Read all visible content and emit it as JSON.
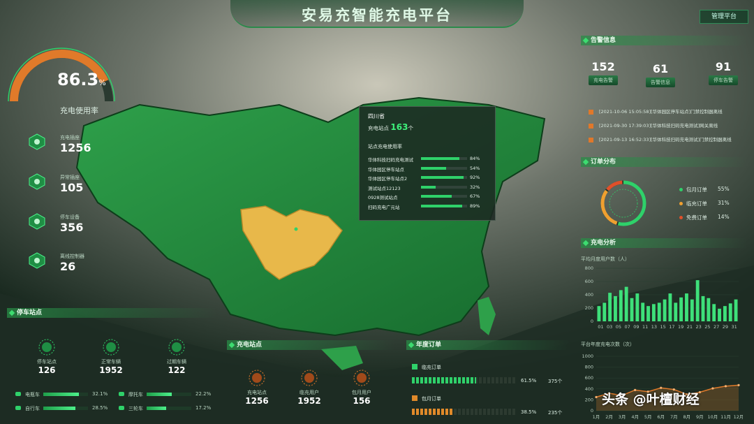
{
  "header": {
    "title": "安易充智能充电平台",
    "mgmt_button": "管理平台"
  },
  "gauge": {
    "value": "86.3",
    "unit": "%",
    "label": "充电使用率",
    "fraction": 0.863
  },
  "left_kpis": [
    {
      "label": "充电插座",
      "value": "1256",
      "icon": "socket-icon"
    },
    {
      "label": "异常插座",
      "value": "105",
      "icon": "warning-icon"
    },
    {
      "label": "停车设备",
      "value": "356",
      "icon": "car-icon"
    },
    {
      "label": "离线控制器",
      "value": "26",
      "icon": "wifi-icon"
    }
  ],
  "parking": {
    "title": "停车站点",
    "stats": [
      {
        "label": "停车站点",
        "value": "126"
      },
      {
        "label": "正常车辆",
        "value": "1952"
      },
      {
        "label": "过期车辆",
        "value": "122"
      }
    ],
    "vehicles": [
      {
        "label": "电瓶车",
        "pct": "32.1%",
        "value": 32.1
      },
      {
        "label": "摩托车",
        "pct": "22.2%",
        "value": 22.2
      },
      {
        "label": "自行车",
        "pct": "28.5%",
        "value": 28.5
      },
      {
        "label": "三轮车",
        "pct": "17.2%",
        "value": 17.2
      }
    ]
  },
  "charging_station": {
    "title": "充电站点",
    "stats": [
      {
        "label": "充电站点",
        "value": "1256"
      },
      {
        "label": "临充用户",
        "value": "1952"
      },
      {
        "label": "包月用户",
        "value": "156"
      }
    ]
  },
  "annual_orders": {
    "title": "年度订单",
    "rows": [
      {
        "label": "临充订单",
        "pct": "61.5%",
        "count": "375个",
        "value": 61.5,
        "color": "#2fd16a"
      },
      {
        "label": "包月订单",
        "pct": "38.5%",
        "count": "235个",
        "value": 38.5,
        "color": "#e08a2a"
      }
    ]
  },
  "tooltip": {
    "province": "四川省",
    "stations_label": "充电站点",
    "stations_value": "163",
    "stations_unit": "个",
    "usage_title": "站点充电使用率",
    "rows": [
      {
        "name": "华体科技扫码充电测试",
        "pct": "84%",
        "value": 84
      },
      {
        "name": "华体园区停车站点",
        "pct": "54%",
        "value": 54
      },
      {
        "name": "华体园区停车站点2",
        "pct": "92%",
        "value": 92
      },
      {
        "name": "测试站点12123",
        "pct": "32%",
        "value": 32
      },
      {
        "name": "0928测试站点",
        "pct": "67%",
        "value": 67
      },
      {
        "name": "扫码充电广元站",
        "pct": "89%",
        "value": 89
      }
    ]
  },
  "alarms": {
    "title": "告警信息",
    "counters": [
      {
        "value": "152",
        "label": "充电告警"
      },
      {
        "value": "61",
        "label": "告警信息"
      },
      {
        "value": "91",
        "label": "停车告警"
      }
    ],
    "items": [
      "[2021-10-06 15:05:58][华体园区停车站点]门禁控制器离线",
      "[2021-09-30 17:39:03][华体科技扫码充电测试]网关离线",
      "[2021-09-13 16:52:33][华体科技扫码充电测试]门禁控制器离线"
    ]
  },
  "order_dist": {
    "title": "订单分布",
    "items": [
      {
        "label": "包月订单",
        "pct": "55%",
        "value": 55,
        "color": "#2fd16a"
      },
      {
        "label": "临充订单",
        "pct": "31%",
        "value": 31,
        "color": "#f0a030"
      },
      {
        "label": "免费订单",
        "pct": "14%",
        "value": 14,
        "color": "#e0502a"
      }
    ]
  },
  "charging_analysis": {
    "title": "充电分析",
    "chart_data": {
      "type": "bar",
      "title": "平均月度用户数（人）",
      "ylim": [
        0,
        800
      ],
      "yticks": [
        "0",
        "200",
        "400",
        "600",
        "800"
      ],
      "categories": [
        "01",
        "03",
        "05",
        "07",
        "09",
        "11",
        "13",
        "15",
        "17",
        "19",
        "21",
        "23",
        "25",
        "27",
        "29",
        "31"
      ],
      "values": [
        230,
        280,
        430,
        380,
        470,
        520,
        350,
        420,
        280,
        230,
        260,
        280,
        330,
        420,
        280,
        360,
        420,
        330,
        620,
        380,
        350,
        260,
        190,
        230,
        270,
        330
      ],
      "tick_labels": [
        "01",
        "03",
        "05",
        "07",
        "09",
        "11",
        "13",
        "15",
        "17",
        "19",
        "21",
        "23",
        "25",
        "27",
        "29",
        "31"
      ]
    }
  },
  "annual_charge": {
    "chart_data": {
      "type": "line",
      "title": "平台年度充电次数（次）",
      "yticks": [
        "0",
        "200",
        "400",
        "600",
        "800",
        "1000"
      ],
      "ylim": [
        0,
        1000
      ],
      "categories": [
        "1月",
        "2月",
        "3月",
        "4月",
        "5月",
        "6月",
        "7月",
        "8月",
        "9月",
        "10月",
        "11月",
        "12月"
      ],
      "values": [
        250,
        320,
        280,
        380,
        350,
        420,
        390,
        300,
        340,
        410,
        450,
        470
      ]
    }
  },
  "watermark": "头条 @叶檀财经",
  "colors": {
    "accent": "#2fd16a",
    "orange": "#e0782a",
    "yellow_region": "#e8b84a"
  }
}
